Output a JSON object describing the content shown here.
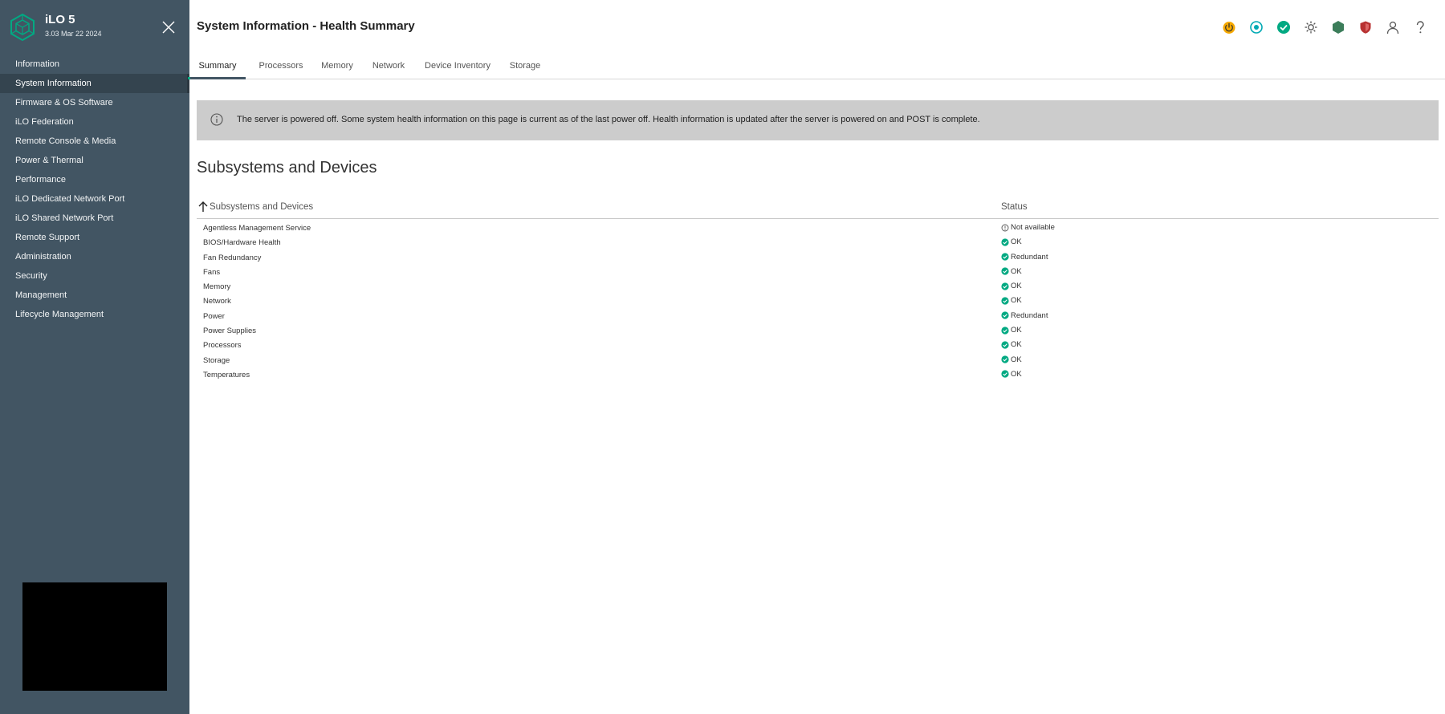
{
  "app": {
    "title": "iLO 5",
    "version": "3.03 Mar 22 2024"
  },
  "sidebar": {
    "items": [
      {
        "label": "Information"
      },
      {
        "label": "System Information"
      },
      {
        "label": "Firmware & OS Software"
      },
      {
        "label": "iLO Federation"
      },
      {
        "label": "Remote Console & Media"
      },
      {
        "label": "Power & Thermal"
      },
      {
        "label": "Performance"
      },
      {
        "label": "iLO Dedicated Network Port"
      },
      {
        "label": "iLO Shared Network Port"
      },
      {
        "label": "Remote Support"
      },
      {
        "label": "Administration"
      },
      {
        "label": "Security"
      },
      {
        "label": "Management"
      },
      {
        "label": "Lifecycle Management"
      }
    ],
    "active_index": 1
  },
  "header": {
    "title": "System Information - Health Summary",
    "icons": [
      "power-icon",
      "locator-uid-icon",
      "health-ok-icon",
      "brightness-icon",
      "hexagon-status-icon",
      "security-shield-icon",
      "user-icon",
      "help-icon"
    ]
  },
  "tabs": [
    {
      "label": "Summary"
    },
    {
      "label": "Processors"
    },
    {
      "label": "Memory"
    },
    {
      "label": "Network"
    },
    {
      "label": "Device Inventory"
    },
    {
      "label": "Storage"
    }
  ],
  "banner": {
    "text": "The server is powered off. Some system health information on this page is current as of the last power off. Health information is updated after the server is powered on and POST is complete."
  },
  "section": {
    "title": "Subsystems and Devices"
  },
  "table": {
    "columns": [
      "Subsystems and Devices",
      "Status"
    ],
    "rows": [
      {
        "name": "Agentless Management Service",
        "status": "Not available",
        "state": "unknown"
      },
      {
        "name": "BIOS/Hardware Health",
        "status": "OK",
        "state": "ok"
      },
      {
        "name": "Fan Redundancy",
        "status": "Redundant",
        "state": "ok"
      },
      {
        "name": "Fans",
        "status": "OK",
        "state": "ok"
      },
      {
        "name": "Memory",
        "status": "OK",
        "state": "ok"
      },
      {
        "name": "Network",
        "status": "OK",
        "state": "ok"
      },
      {
        "name": "Power",
        "status": "Redundant",
        "state": "ok"
      },
      {
        "name": "Power Supplies",
        "status": "OK",
        "state": "ok"
      },
      {
        "name": "Processors",
        "status": "OK",
        "state": "ok"
      },
      {
        "name": "Storage",
        "status": "OK",
        "state": "ok"
      },
      {
        "name": "Temperatures",
        "status": "OK",
        "state": "ok"
      }
    ]
  },
  "colors": {
    "sidebar": "#425563",
    "sidebar_active": "#34444f",
    "ok": "#01a982",
    "power": "#f5a800",
    "shield": "#c0392b",
    "banner": "#cccccc"
  }
}
